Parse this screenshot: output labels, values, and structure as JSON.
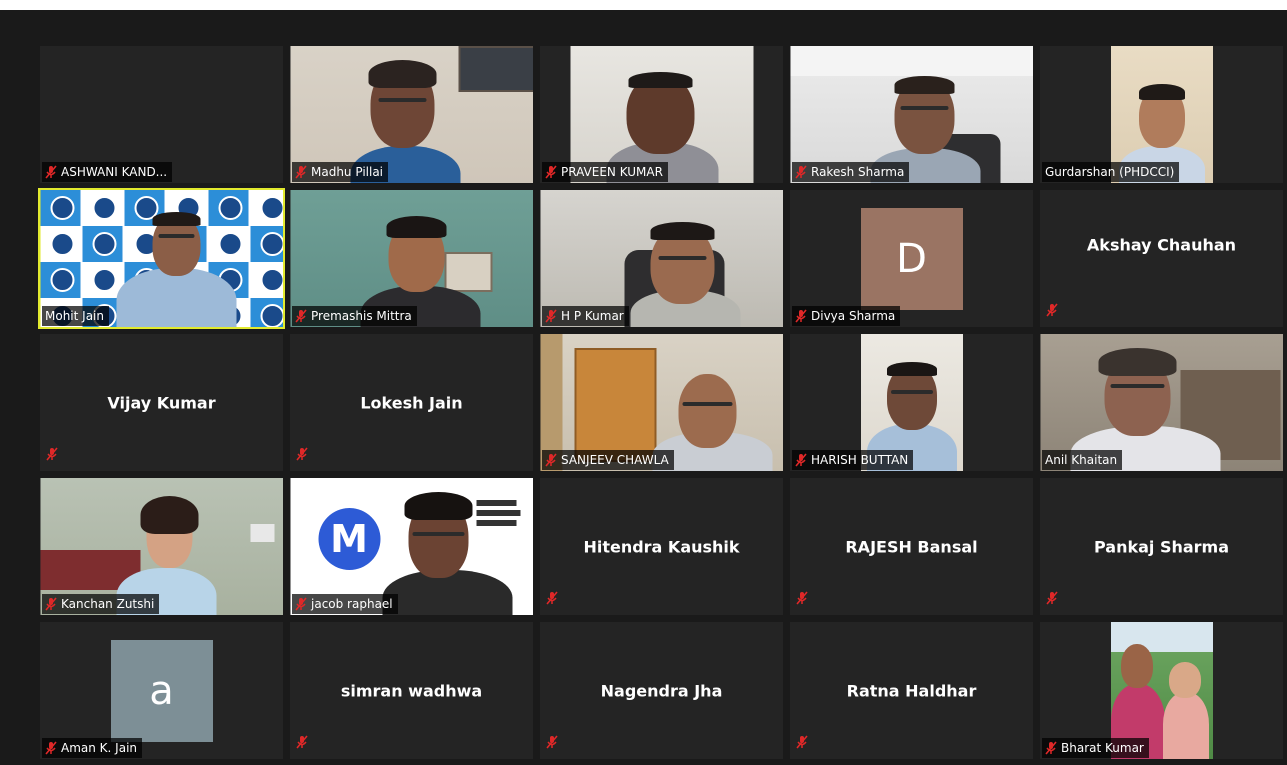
{
  "participants": [
    {
      "name": "ASHWANI KAND...",
      "type": "label",
      "muted": true
    },
    {
      "name": "Madhu Pillai",
      "type": "video",
      "muted": true
    },
    {
      "name": "PRAVEEN KUMAR",
      "type": "video",
      "muted": true
    },
    {
      "name": "Rakesh Sharma",
      "type": "video",
      "muted": true
    },
    {
      "name": "Gurdarshan (PHDCCI)",
      "type": "video",
      "muted": false
    },
    {
      "name": "Mohit Jain",
      "type": "video",
      "muted": false,
      "active": true
    },
    {
      "name": "Premashis Mittra",
      "type": "video",
      "muted": true
    },
    {
      "name": "H P Kumar",
      "type": "video",
      "muted": true
    },
    {
      "name": "Divya Sharma",
      "type": "avatar",
      "muted": true,
      "initial": "D",
      "avatar_color": "#9a7463"
    },
    {
      "name": "Akshay Chauhan",
      "type": "name",
      "muted": true
    },
    {
      "name": "Vijay Kumar",
      "type": "name",
      "muted": true
    },
    {
      "name": "Lokesh Jain",
      "type": "name",
      "muted": true
    },
    {
      "name": "SANJEEV CHAWLA",
      "type": "video",
      "muted": true
    },
    {
      "name": "HARISH BUTTAN",
      "type": "video",
      "muted": true
    },
    {
      "name": "Anil Khaitan",
      "type": "video",
      "muted": false
    },
    {
      "name": "Kanchan Zutshi",
      "type": "video",
      "muted": true
    },
    {
      "name": "jacob raphael",
      "type": "video",
      "muted": true,
      "logo_letter": "M"
    },
    {
      "name": "Hitendra Kaushik",
      "type": "name",
      "muted": true
    },
    {
      "name": "RAJESH Bansal",
      "type": "name",
      "muted": true
    },
    {
      "name": "Pankaj Sharma",
      "type": "name",
      "muted": true
    },
    {
      "name": "Aman K. Jain",
      "type": "avatar",
      "muted": true,
      "initial": "a",
      "avatar_color": "#7d8f96"
    },
    {
      "name": "simran wadhwa",
      "type": "name",
      "muted": true
    },
    {
      "name": "Nagendra Jha",
      "type": "name",
      "muted": true
    },
    {
      "name": "Ratna Haldhar",
      "type": "name",
      "muted": true
    },
    {
      "name": "Bharat Kumar",
      "type": "video",
      "muted": true
    }
  ],
  "colors": {
    "mute_red": "#e02828",
    "active_speaker": "#e2ea2e",
    "tile_bg": "#242424",
    "stage_bg": "#1a1a1a"
  }
}
